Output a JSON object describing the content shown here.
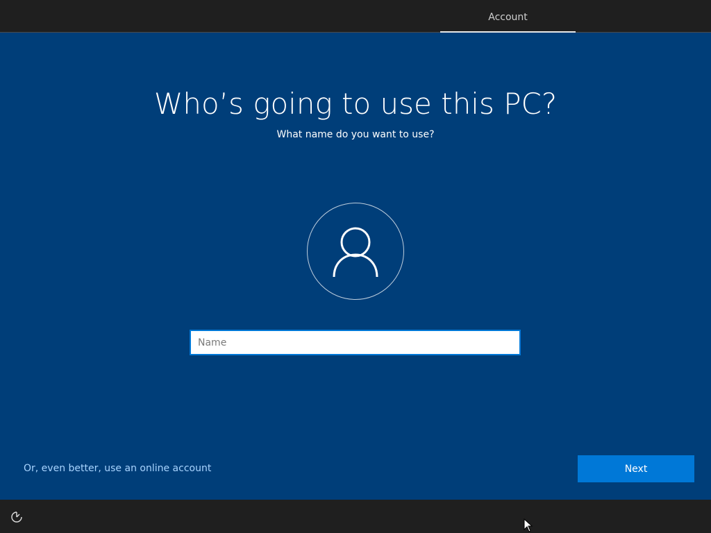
{
  "header": {
    "tab_label": "Account"
  },
  "main": {
    "title": "Who’s going to use this PC?",
    "subtitle": "What name do you want to use?",
    "avatar_icon": "user-icon",
    "name_input": {
      "value": "",
      "placeholder": "Name"
    }
  },
  "footer": {
    "online_link": "Or, even better, use an online account",
    "next_label": "Next"
  },
  "bottom_bar": {
    "ease_icon": "ease-of-access-icon"
  },
  "colors": {
    "background": "#003e79",
    "accent": "#0078d7",
    "bar": "#1f1f1f",
    "link": "#a8d4ff"
  }
}
